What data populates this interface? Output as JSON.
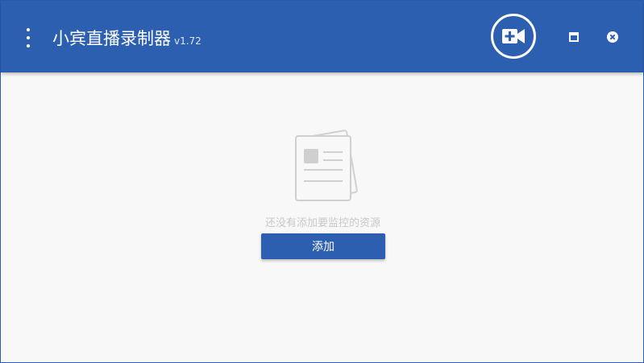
{
  "app": {
    "title": "小宾直播录制器",
    "version": "v1.72"
  },
  "titlebar": {
    "menu_icon": "more-vert-icon",
    "record_icon": "video-add-icon",
    "maximize_icon": "maximize-icon",
    "close_icon": "close-circle-icon",
    "background": "#2c5fb0"
  },
  "empty_state": {
    "icon": "document-icon",
    "message": "还没有添加要监控的资源",
    "button_label": "添加"
  },
  "colors": {
    "accent": "#2c5fb0",
    "muted_text": "#c8c8c8"
  }
}
